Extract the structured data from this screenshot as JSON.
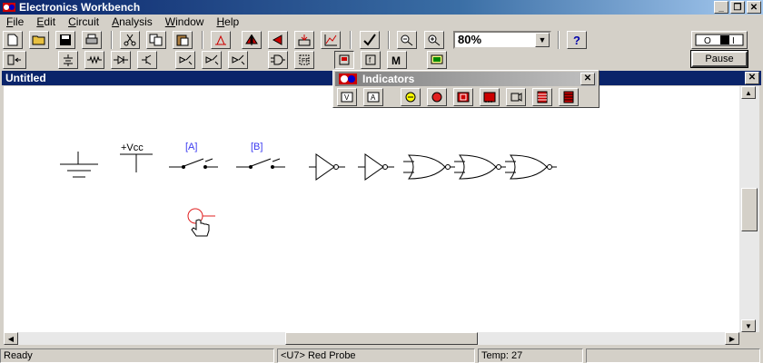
{
  "window": {
    "title": "Electronics Workbench"
  },
  "menu": [
    {
      "label": "File",
      "key": "F",
      "rest": "ile"
    },
    {
      "label": "Edit",
      "key": "E",
      "rest": "dit"
    },
    {
      "label": "Circuit",
      "key": "C",
      "rest": "ircuit"
    },
    {
      "label": "Analysis",
      "key": "A",
      "rest": "nalysis"
    },
    {
      "label": "Window",
      "key": "W",
      "rest": "indow"
    },
    {
      "label": "Help",
      "key": "H",
      "rest": "elp"
    }
  ],
  "toolbar": {
    "zoom_value": "80%"
  },
  "simulation": {
    "pause_label": "Pause"
  },
  "document": {
    "title": "Untitled"
  },
  "indicators": {
    "title": "Indicators"
  },
  "canvas": {
    "vcc_label": "+Vcc",
    "switch_a_label": "[A]",
    "switch_b_label": "[B]",
    "label_color": "#3a3af0",
    "probe_color": "#e02020"
  },
  "status": {
    "state": "Ready",
    "message": "<U7> Red Probe",
    "temp": "Temp:  27"
  },
  "colors": {
    "title_active": "#0a246a",
    "face": "#d4d0c8"
  }
}
